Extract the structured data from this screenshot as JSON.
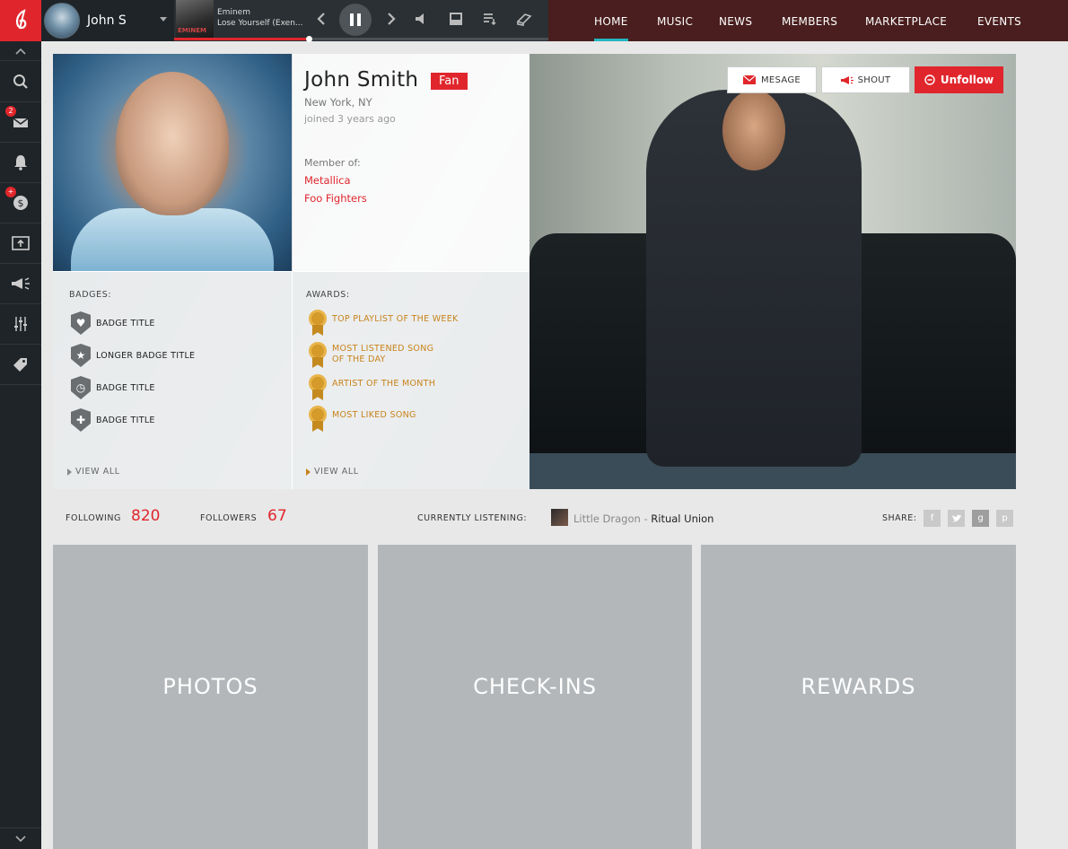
{
  "user": {
    "name": "John S"
  },
  "player": {
    "artist": "Eminem",
    "track": "Lose Yourself (Exen...",
    "album_tag": "EMINEM",
    "progress": 0.36
  },
  "nav": {
    "items": [
      "HOME",
      "MUSIC",
      "NEWS",
      "MEMBERS",
      "MARKETPLACE",
      "EVENTS"
    ],
    "active": "HOME"
  },
  "sidebar": {
    "messages_count": "2",
    "offers_badge": "+"
  },
  "profile": {
    "name": "John Smith",
    "role": "Fan",
    "location": "New York, NY",
    "joined": "joined 3 years ago",
    "member_of_label": "Member of:",
    "groups": [
      "Metallica",
      "Foo Fighters"
    ]
  },
  "badges": {
    "label": "BADGES:",
    "items": [
      "BADGE TITLE",
      "LONGER BADGE TITLE",
      "BADGE TITLE",
      "BADGE TITLE"
    ],
    "view_all": "VIEW ALL"
  },
  "awards": {
    "label": "AWARDS:",
    "items": [
      [
        "TOP PLAYLIST OF THE WEEK"
      ],
      [
        "MOST LISTENED SONG",
        "OF THE DAY"
      ],
      [
        "ARTIST OF THE MONTH"
      ],
      [
        "MOST LIKED SONG"
      ]
    ],
    "view_all": "VIEW ALL"
  },
  "actions": {
    "message": "MESAGE",
    "shout": "SHOUT",
    "unfollow": "Unfollow"
  },
  "stats": {
    "following_label": "FOLLOWING",
    "following": "820",
    "followers_label": "FOLLOWERS",
    "followers": "67",
    "listening_label": "CURRENTLY LISTENING:",
    "listening_artist": "Little Dragon",
    "listening_separator": " - ",
    "listening_track": "Ritual Union",
    "share_label": "SHARE:"
  },
  "tiles": [
    "PHOTOS",
    "CHECK-INS",
    "REWARDS"
  ],
  "colors": {
    "accent": "#e0262c",
    "nav_active": "#25b6c0",
    "award": "#c8831a"
  }
}
